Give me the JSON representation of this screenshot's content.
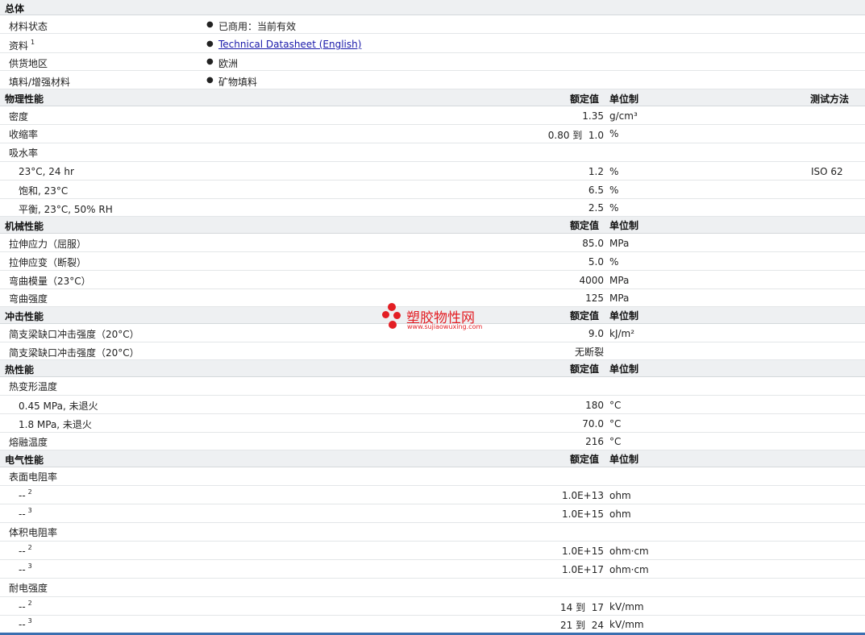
{
  "general": {
    "title": "总体",
    "rows": [
      {
        "label": "材料状态",
        "value": "已商用：当前有效"
      },
      {
        "label": "资料",
        "sup": "1",
        "link": "Technical Datasheet (English)"
      },
      {
        "label": "供货地区",
        "value": "欧洲"
      },
      {
        "label": "填料/增强材料",
        "value": "矿物填料"
      }
    ]
  },
  "headers": {
    "nominal": "额定值",
    "unit": "单位制",
    "method": "测试方法"
  },
  "physical": {
    "title": "物理性能",
    "density": {
      "label": "密度",
      "value": "1.35",
      "unit": "g/cm³"
    },
    "shrink": {
      "label": "收缩率",
      "value": "0.80 到  1.0",
      "unit": "%"
    },
    "water": {
      "label": "吸水率"
    },
    "w1": {
      "label": "23°C, 24 hr",
      "value": "1.2",
      "unit": "%",
      "method": "ISO 62"
    },
    "w2": {
      "label": "饱和, 23°C",
      "value": "6.5",
      "unit": "%"
    },
    "w3": {
      "label": "平衡, 23°C, 50% RH",
      "value": "2.5",
      "unit": "%"
    }
  },
  "mechanical": {
    "title": "机械性能",
    "r1": {
      "label": "拉伸应力（屈服）",
      "value": "85.0",
      "unit": "MPa"
    },
    "r2": {
      "label": "拉伸应变（断裂）",
      "value": "5.0",
      "unit": "%"
    },
    "r3": {
      "label": "弯曲模量（23°C）",
      "value": "4000",
      "unit": "MPa"
    },
    "r4": {
      "label": "弯曲强度",
      "value": "125",
      "unit": "MPa"
    }
  },
  "impact": {
    "title": "冲击性能",
    "r1": {
      "label": "简支梁缺口冲击强度（20°C）",
      "value": "9.0",
      "unit": "kJ/m²"
    },
    "r2": {
      "label": "简支梁缺口冲击强度（20°C）",
      "value": "无断裂"
    }
  },
  "thermal": {
    "title": "热性能",
    "hdt": {
      "label": "热变形温度"
    },
    "h1": {
      "label": "0.45 MPa, 未退火",
      "value": "180",
      "unit": "°C"
    },
    "h2": {
      "label": "1.8 MPa, 未退火",
      "value": "70.0",
      "unit": "°C"
    },
    "melt": {
      "label": "熔融温度",
      "value": "216",
      "unit": "°C"
    }
  },
  "electrical": {
    "title": "电气性能",
    "surface": {
      "label": "表面电阻率"
    },
    "s1": {
      "label": "--",
      "sup": "2",
      "value": "1.0E+13",
      "unit": "ohm"
    },
    "s2": {
      "label": "--",
      "sup": "3",
      "value": "1.0E+15",
      "unit": "ohm"
    },
    "volume": {
      "label": "体积电阻率"
    },
    "v1": {
      "label": "--",
      "sup": "2",
      "value": "1.0E+15",
      "unit": "ohm·cm"
    },
    "v2": {
      "label": "--",
      "sup": "3",
      "value": "1.0E+17",
      "unit": "ohm·cm"
    },
    "dielectric": {
      "label": "耐电强度"
    },
    "d1": {
      "label": "--",
      "sup": "2",
      "value": "14 到  17",
      "unit": "kV/mm"
    },
    "d2": {
      "label": "--",
      "sup": "3",
      "value": "21 到  24",
      "unit": "kV/mm"
    }
  },
  "watermark": {
    "text": "塑胶物性网",
    "url": "www.sujiaowuxing.com",
    "color": "#e31e24"
  }
}
